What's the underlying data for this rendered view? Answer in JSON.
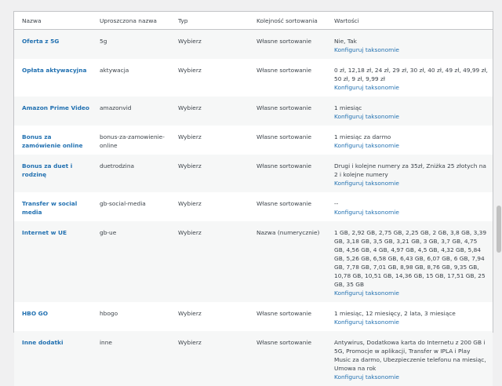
{
  "headers": [
    "Nazwa",
    "Uproszczona nazwa",
    "Typ",
    "Kolejność sortowania",
    "Wartości"
  ],
  "configure_label": "Konfiguruj taksonomie",
  "rows": [
    {
      "name": "Oferta z 5G",
      "slug": "5g",
      "type": "Wybierz",
      "sort": "Własne sortowanie",
      "values": "Nie, Tak"
    },
    {
      "name": "Opłata aktywacyjna",
      "slug": "aktywacja",
      "type": "Wybierz",
      "sort": "Własne sortowanie",
      "values": "0 zł, 12,18 zł, 24 zł, 29 zł, 30 zł, 40 zł, 49 zł, 49,99 zł, 50 zł, 9 zł, 9,99 zł"
    },
    {
      "name": "Amazon Prime Video",
      "slug": "amazonvid",
      "type": "Wybierz",
      "sort": "Własne sortowanie",
      "values": "1 miesiąc"
    },
    {
      "name": "Bonus za zamówienie online",
      "slug": "bonus-za-zamowienie-online",
      "type": "Wybierz",
      "sort": "Własne sortowanie",
      "values": "1 miesiąc za darmo"
    },
    {
      "name": "Bonus za duet i rodzinę",
      "slug": "duetrodzina",
      "type": "Wybierz",
      "sort": "Własne sortowanie",
      "values": "Drugi i kolejne numery za 35zł, Zniżka 25 złotych na 2 i kolejne numery"
    },
    {
      "name": "Transfer w social media",
      "slug": "gb-social-media",
      "type": "Wybierz",
      "sort": "Własne sortowanie",
      "values": "--"
    },
    {
      "name": "Internet w UE",
      "slug": "gb-ue",
      "type": "Wybierz",
      "sort": "Nazwa (numerycznie)",
      "values": "1 GB, 2,92 GB, 2,75 GB, 2,25 GB, 2 GB, 3,8 GB, 3,39 GB, 3,18 GB, 3,5 GB, 3,21 GB, 3 GB, 3,7 GB, 4,75 GB, 4,56 GB, 4 GB, 4,97 GB, 4,5 GB, 4,32 GB, 5,84 GB, 5,26 GB, 6,58 GB, 6,43 GB, 6,07 GB, 6 GB, 7,94 GB, 7,78 GB, 7,01 GB, 8,98 GB, 8,76 GB, 9,35 GB, 10,78 GB, 10,51 GB, 14,36 GB, 15 GB, 17,51 GB, 25 GB, 35 GB"
    },
    {
      "name": "HBO GO",
      "slug": "hbogo",
      "type": "Wybierz",
      "sort": "Własne sortowanie",
      "values": "1 miesiąc, 12 miesięcy, 2 lata, 3 miesiące"
    },
    {
      "name": "Inne dodatki",
      "slug": "inne",
      "type": "Wybierz",
      "sort": "Własne sortowanie",
      "values": "Antywirus, Dodatkowa karta do Internetu z 200 GB i 5G, Promocje w aplikacji, Transfer w IPLA i Play Music za darmo, Ubezpieczenie telefonu na miesiąc, Umowa na rok"
    }
  ]
}
